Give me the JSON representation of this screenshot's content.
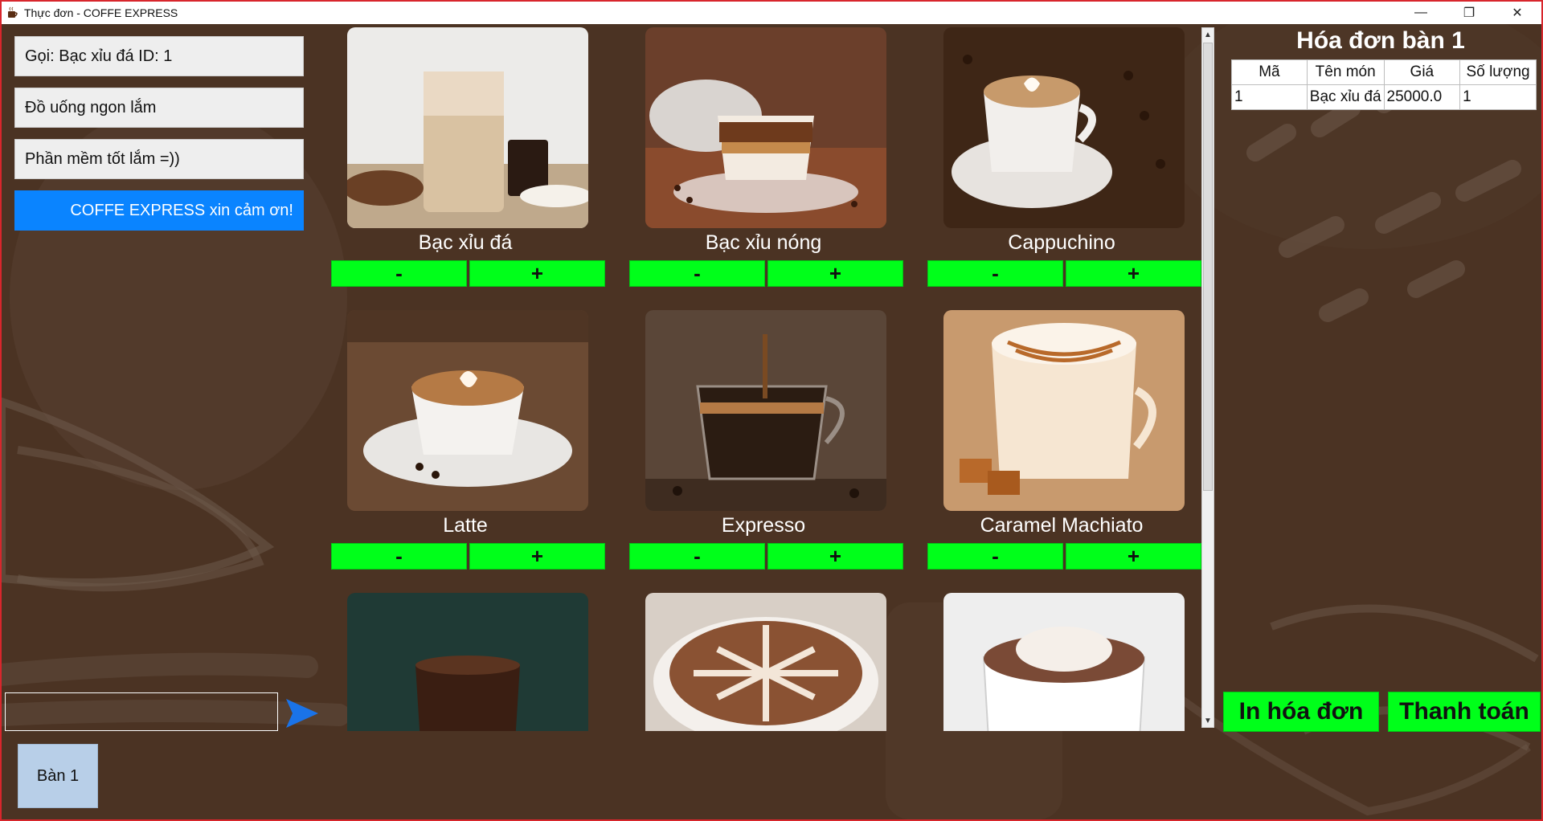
{
  "window": {
    "title": "Thực đơn - COFFE EXPRESS",
    "controls": {
      "minimize": "—",
      "maximize": "❐",
      "close": "✕"
    }
  },
  "chat": {
    "messages": [
      "Gọi: Bạc xỉu đá ID: 1",
      "Đồ uống ngon lắm",
      "Phần mềm tốt lắm =))",
      "COFFE EXPRESS xin cảm ơn!"
    ],
    "input_value": "",
    "send_icon": "send-arrow-icon"
  },
  "table_button": "Bàn 1",
  "menu": {
    "items": [
      {
        "name": "Bạc xỉu đá",
        "minus": "-",
        "plus": "+"
      },
      {
        "name": "Bạc xỉu nóng",
        "minus": "-",
        "plus": "+"
      },
      {
        "name": "Cappuchino",
        "minus": "-",
        "plus": "+"
      },
      {
        "name": "Latte",
        "minus": "-",
        "plus": "+"
      },
      {
        "name": "Expresso",
        "minus": "-",
        "plus": "+"
      },
      {
        "name": "Caramel Machiato",
        "minus": "-",
        "plus": "+"
      },
      {
        "name": "",
        "minus": "",
        "plus": ""
      },
      {
        "name": "",
        "minus": "",
        "plus": ""
      },
      {
        "name": "",
        "minus": "",
        "plus": ""
      }
    ]
  },
  "invoice": {
    "title": "Hóa đơn bàn  1",
    "columns": [
      "Mã",
      "Tên món",
      "Giá",
      "Số lượng"
    ],
    "rows": [
      [
        "1",
        "Bạc xỉu đá",
        "25000.0",
        "1"
      ]
    ],
    "print_button": "In hóa đơn",
    "pay_button": "Thanh toán"
  },
  "colors": {
    "background": "#4b3323",
    "accent_green": "#00ff1a",
    "accent_blue": "#0a84ff",
    "border_red": "#d8262c"
  }
}
